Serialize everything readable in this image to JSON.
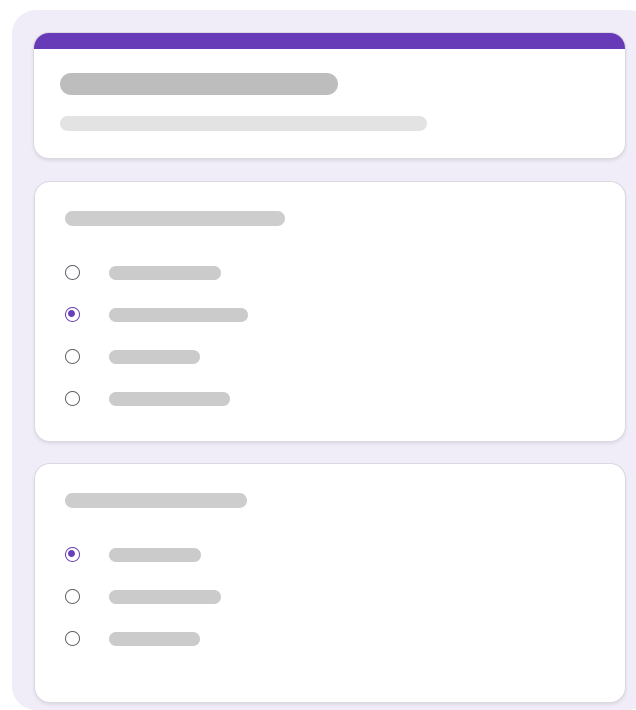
{
  "colors": {
    "accent": "#673ab7",
    "frame_background": "#f0ecf8",
    "card_background": "#ffffff",
    "title_placeholder": "#bdbdbd",
    "text_placeholder": "#e0e0e0",
    "option_placeholder": "#cccccc",
    "radio_selected": "#6a3fb5",
    "radio_unselected": "#5f5f66"
  },
  "form": {
    "header": {
      "title_placeholder": "",
      "description_placeholder": ""
    },
    "questions": [
      {
        "label_placeholder": "",
        "options": [
          {
            "label": "",
            "selected": false
          },
          {
            "label": "",
            "selected": true
          },
          {
            "label": "",
            "selected": false
          },
          {
            "label": "",
            "selected": false
          }
        ]
      },
      {
        "label_placeholder": "",
        "options": [
          {
            "label": "",
            "selected": true
          },
          {
            "label": "",
            "selected": false
          },
          {
            "label": "",
            "selected": false
          }
        ]
      }
    ]
  }
}
